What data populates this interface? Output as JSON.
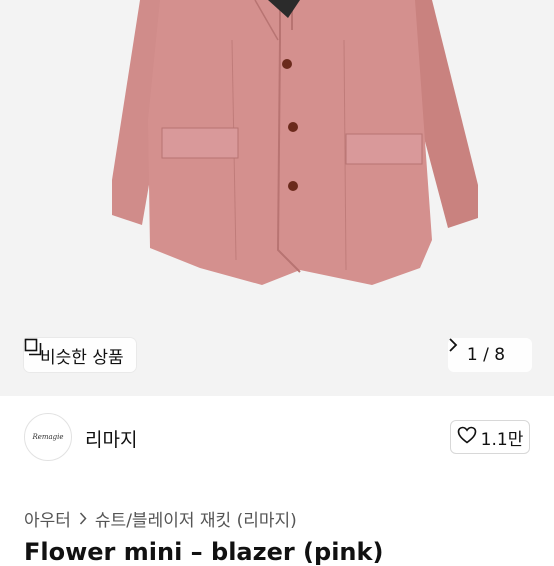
{
  "product_image": {
    "similar_button_label": "비슷한 상품",
    "pager_text": "1 / 8",
    "colors": {
      "background": "#f3f3f3",
      "jacket": "#d4908e",
      "button": "#6b2a1c"
    }
  },
  "store": {
    "logo_text": "Remagie",
    "name": "리마지",
    "like_count": "1.1만"
  },
  "breadcrumb": {
    "items": [
      "아우터",
      "슈트/블레이저 재킷 (리마지)"
    ]
  },
  "product": {
    "title": "Flower mini – blazer (pink)"
  },
  "icons": [
    "similar-items-icon",
    "chevron-right-icon",
    "heart-icon",
    "chevron-right-icon"
  ]
}
